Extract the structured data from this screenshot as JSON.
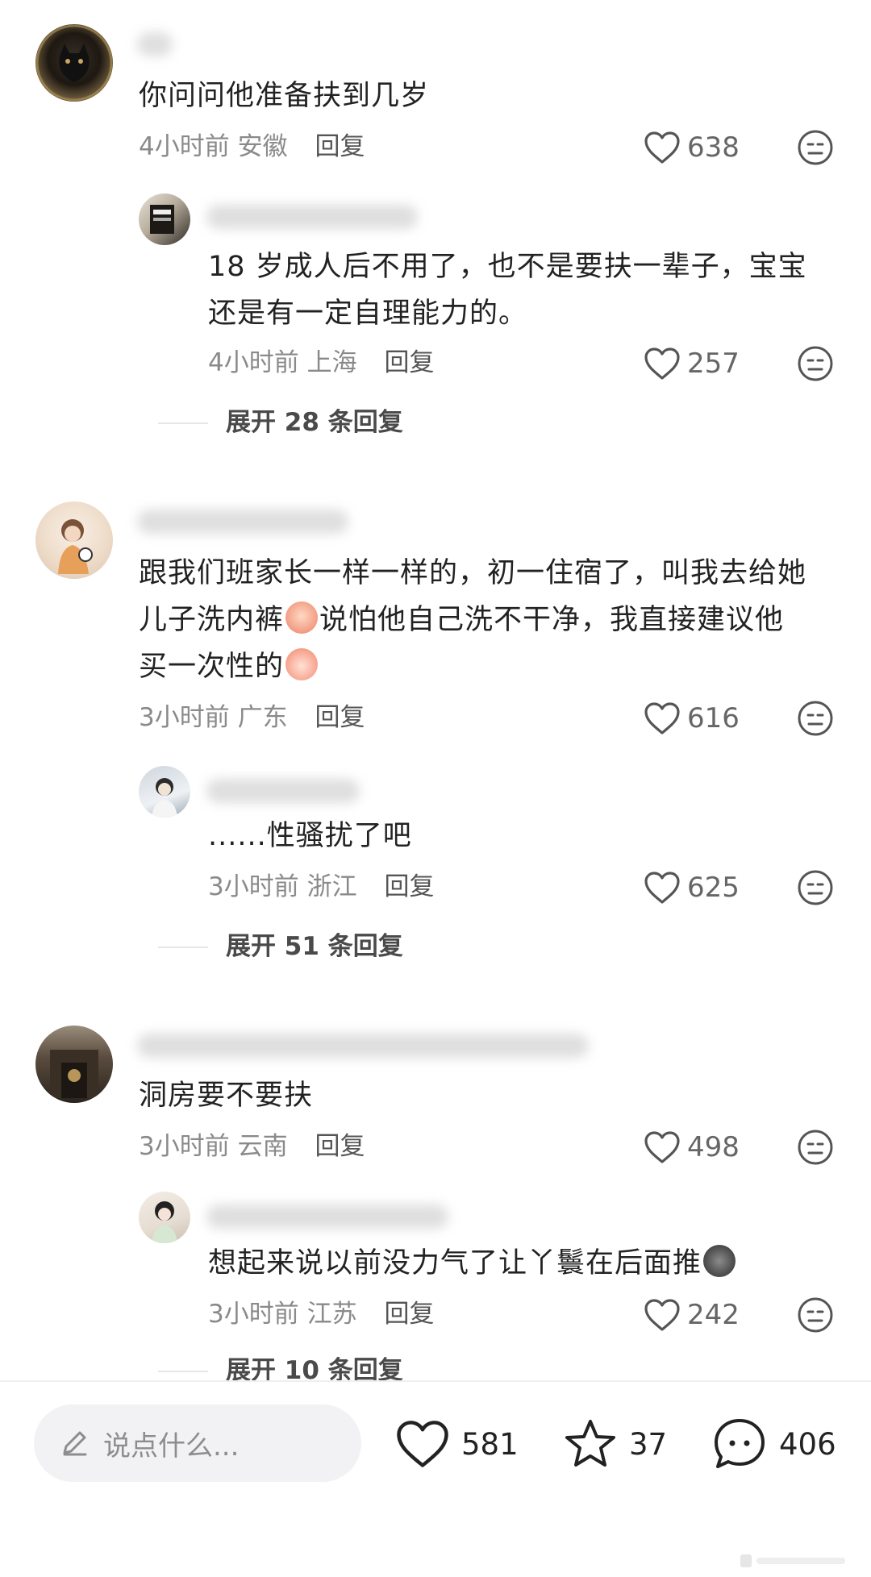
{
  "comments": [
    {
      "text": "你问问他准备扶到几岁",
      "time": "4小时前",
      "location": "安徽",
      "reply_label": "回复",
      "likes": "638",
      "replies": [
        {
          "text_lines": [
            "18 岁成人后不用了，也不是要扶一辈子，宝宝",
            "还是有一定自理能力的。"
          ],
          "time": "4小时前",
          "location": "上海",
          "reply_label": "回复",
          "likes": "257"
        }
      ],
      "expand_label": "展开 28 条回复"
    },
    {
      "text_lines": [
        "跟我们班家长一样一样的，初一住宿了，叫我去给她",
        "儿子洗内裤",
        "说怕他自己洗不干净，我直接建议他",
        "买一次性的"
      ],
      "emoji_1": "crying-face",
      "emoji_2": "peach-face",
      "time": "3小时前",
      "location": "广东",
      "reply_label": "回复",
      "likes": "616",
      "replies": [
        {
          "text": "......性骚扰了吧",
          "time": "3小时前",
          "location": "浙江",
          "reply_label": "回复",
          "likes": "625"
        }
      ],
      "expand_label": "展开 51 条回复"
    },
    {
      "text": "洞房要不要扶",
      "time": "3小时前",
      "location": "云南",
      "reply_label": "回复",
      "likes": "498",
      "replies": [
        {
          "text": "想起来说以前没力气了让丫鬟在后面推",
          "emoji": "cat-face",
          "time": "3小时前",
          "location": "江苏",
          "reply_label": "回复",
          "likes": "242"
        }
      ],
      "expand_label": "展开 10 条回复"
    }
  ],
  "bottom_bar": {
    "input_placeholder": "说点什么...",
    "likes": "581",
    "favorites": "37",
    "comments": "406"
  },
  "colors": {
    "text": "#222222",
    "meta": "#8a8a8a",
    "pill_bg": "#f2f2f4"
  }
}
